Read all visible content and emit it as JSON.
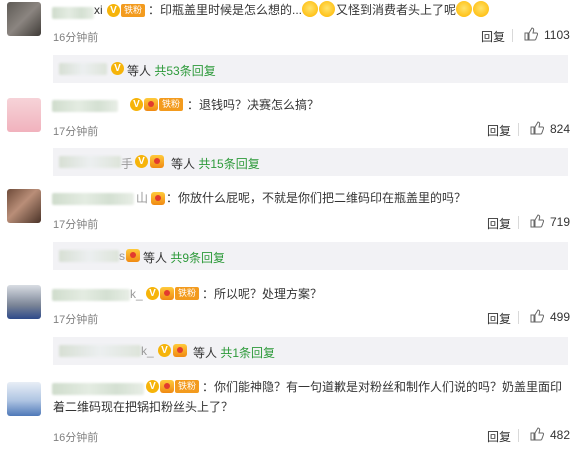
{
  "comments": [
    {
      "name_tail": "xi",
      "badge": "铁粉",
      "text_before": "：印瓶盖里时候是怎么想的...",
      "text_after": "又怪到消费者头上了呢",
      "time": "16分钟前",
      "reply": "回复",
      "likes": "1103"
    },
    {
      "name_tail": "",
      "badge": "铁粉",
      "text": "：退钱吗？决赛怎么搞？",
      "time": "17分钟前",
      "reply": "回复",
      "likes": "824"
    },
    {
      "name_tail": "山",
      "text": "：你放什么屁呢，不就是你们把二维码印在瓶盖里的吗？",
      "time": "17分钟前",
      "reply": "回复",
      "likes": "719"
    },
    {
      "name_tail": "k_",
      "badge": "铁粉",
      "text": "：所以呢？处理方案？",
      "time": "17分钟前",
      "reply": "回复",
      "likes": "499"
    },
    {
      "name_tail": "",
      "badge": "铁粉",
      "text": "：你们能神隐？有一句道歉是对粉丝和制作人们说的吗？奶盖里面印着二维码现在把锅扣粉丝头上了？",
      "time": "16分钟前",
      "reply": "回复",
      "likes": "482"
    }
  ],
  "reply_summaries": [
    {
      "name_tail": "",
      "text": "等人",
      "count": "共53条回复"
    },
    {
      "name_tail": "手",
      "text": "等人",
      "count": "共15条回复"
    },
    {
      "name_tail": "s",
      "text": "等人",
      "count": "共9条回复"
    },
    {
      "name_tail": "k_",
      "text": "等人",
      "count": "共1条回复"
    }
  ]
}
